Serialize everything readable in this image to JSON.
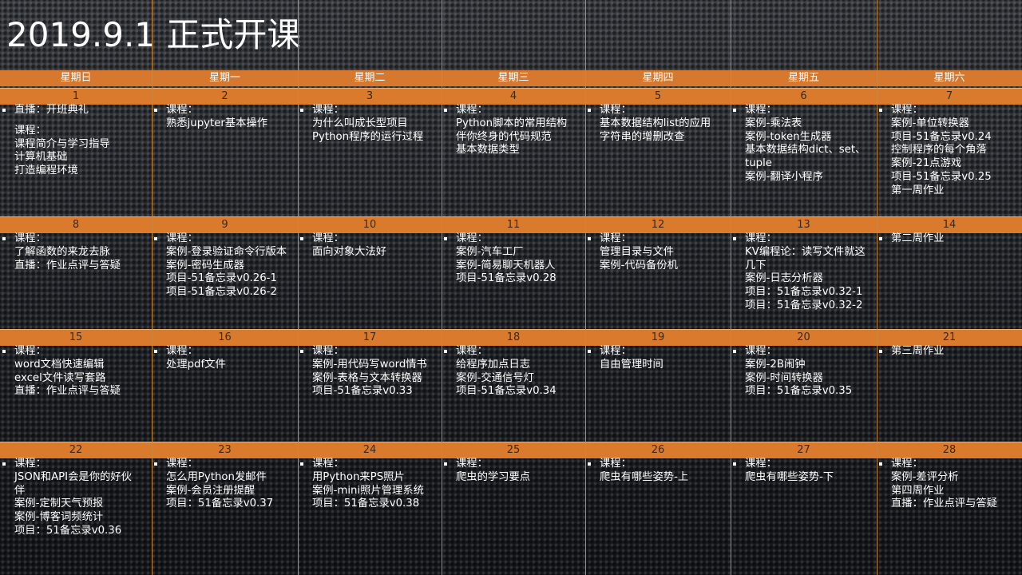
{
  "title": "2019.9.1 正式开课",
  "colors": {
    "header_bar": "#d6782e",
    "number_bar": "#d97a2d",
    "grid_line": "#c8873c",
    "text": "#ffffff"
  },
  "weekdays": [
    "星期日",
    "星期一",
    "星期二",
    "星期三",
    "星期四",
    "星期五",
    "星期六"
  ],
  "weeks": [
    {
      "days": [
        {
          "num": "1",
          "lines": [
            {
              "t": "直播：开班典礼",
              "b": true
            },
            {
              "gap": true
            },
            {
              "t": "课程：",
              "b": false
            },
            {
              "t": "课程简介与学习指导"
            },
            {
              "t": "计算机基础"
            },
            {
              "t": "打造编程环境"
            }
          ]
        },
        {
          "num": "2",
          "lines": [
            {
              "t": "课程：",
              "b": true
            },
            {
              "t": "熟悉jupyter基本操作"
            }
          ]
        },
        {
          "num": "3",
          "lines": [
            {
              "t": "课程：",
              "b": true
            },
            {
              "t": "为什么叫成长型项目"
            },
            {
              "t": "Python程序的运行过程"
            }
          ]
        },
        {
          "num": "4",
          "lines": [
            {
              "t": "课程：",
              "b": true
            },
            {
              "t": "Python脚本的常用结构"
            },
            {
              "t": "伴你终身的代码规范"
            },
            {
              "t": "基本数据类型"
            }
          ]
        },
        {
          "num": "5",
          "lines": [
            {
              "t": "课程：",
              "b": true
            },
            {
              "t": "基本数据结构list的应用"
            },
            {
              "t": "字符串的增删改查"
            }
          ]
        },
        {
          "num": "6",
          "lines": [
            {
              "t": "课程：",
              "b": true
            },
            {
              "t": "案例-乘法表"
            },
            {
              "t": "案例-token生成器"
            },
            {
              "t": "基本数据结构dict、set、"
            },
            {
              "t": "tuple"
            },
            {
              "t": "案例-翻译小程序"
            }
          ]
        },
        {
          "num": "7",
          "lines": [
            {
              "t": "课程：",
              "b": true
            },
            {
              "t": "案例-单位转换器"
            },
            {
              "t": "项目-51备忘录v0.24"
            },
            {
              "t": "控制程序的每个角落"
            },
            {
              "t": "案例-21点游戏"
            },
            {
              "t": "项目-51备忘录v0.25"
            },
            {
              "t": "第一周作业"
            }
          ]
        }
      ]
    },
    {
      "days": [
        {
          "num": "8",
          "lines": [
            {
              "t": "课程：",
              "b": true
            },
            {
              "t": "了解函数的来龙去脉"
            },
            {
              "t": "直播：作业点评与答疑"
            }
          ]
        },
        {
          "num": "9",
          "lines": [
            {
              "t": "课程：",
              "b": true
            },
            {
              "t": "案例-登录验证命令行版本"
            },
            {
              "t": "案例-密码生成器"
            },
            {
              "t": "项目-51备忘录v0.26-1"
            },
            {
              "t": "项目-51备忘录v0.26-2"
            }
          ]
        },
        {
          "num": "10",
          "lines": [
            {
              "t": "课程：",
              "b": true
            },
            {
              "t": "面向对象大法好"
            }
          ]
        },
        {
          "num": "11",
          "lines": [
            {
              "t": "课程：",
              "b": true
            },
            {
              "t": "案例-汽车工厂"
            },
            {
              "t": "案例-简易聊天机器人"
            },
            {
              "t": "项目-51备忘录v0.28"
            }
          ]
        },
        {
          "num": "12",
          "lines": [
            {
              "t": "课程：",
              "b": true
            },
            {
              "t": "管理目录与文件"
            },
            {
              "t": "案例-代码备份机"
            }
          ]
        },
        {
          "num": "13",
          "lines": [
            {
              "t": "课程：",
              "b": true
            },
            {
              "t": "KV编程论：读写文件就这"
            },
            {
              "t": "几下"
            },
            {
              "t": "案例-日志分析器"
            },
            {
              "t": "项目：51备忘录v0.32-1"
            },
            {
              "t": "项目：51备忘录v0.32-2"
            }
          ]
        },
        {
          "num": "14",
          "lines": [
            {
              "t": "第二周作业",
              "b": true
            }
          ]
        }
      ]
    },
    {
      "days": [
        {
          "num": "15",
          "lines": [
            {
              "t": "课程：",
              "b": true
            },
            {
              "t": "word文档快速编辑"
            },
            {
              "t": "excel文件读写套路"
            },
            {
              "t": "直播：作业点评与答疑"
            }
          ]
        },
        {
          "num": "16",
          "lines": [
            {
              "t": "课程：",
              "b": true
            },
            {
              "t": "处理pdf文件"
            }
          ]
        },
        {
          "num": "17",
          "lines": [
            {
              "t": "课程：",
              "b": true
            },
            {
              "t": "案例-用代码写word情书"
            },
            {
              "t": "案例-表格与文本转换器"
            },
            {
              "t": "项目-51备忘录v0.33"
            }
          ]
        },
        {
          "num": "18",
          "lines": [
            {
              "t": "课程：",
              "b": true
            },
            {
              "t": "给程序加点日志"
            },
            {
              "t": "案例-交通信号灯"
            },
            {
              "t": "项目-51备忘录v0.34"
            }
          ]
        },
        {
          "num": "19",
          "lines": [
            {
              "t": "课程：",
              "b": true
            },
            {
              "t": "自由管理时间"
            }
          ]
        },
        {
          "num": "20",
          "lines": [
            {
              "t": "课程：",
              "b": true
            },
            {
              "t": "案例-2B闹钟"
            },
            {
              "t": "案例-时间转换器"
            },
            {
              "t": "项目：51备忘录v0.35"
            }
          ]
        },
        {
          "num": "21",
          "lines": [
            {
              "t": "第三周作业",
              "b": true
            }
          ]
        }
      ]
    },
    {
      "days": [
        {
          "num": "22",
          "lines": [
            {
              "t": "课程：",
              "b": true
            },
            {
              "t": "JSON和API会是你的好伙"
            },
            {
              "t": "伴"
            },
            {
              "t": "案例-定制天气预报"
            },
            {
              "t": "案例-博客词频统计"
            },
            {
              "t": "项目：51备忘录v0.36"
            }
          ]
        },
        {
          "num": "23",
          "lines": [
            {
              "t": "课程：",
              "b": true
            },
            {
              "t": "怎么用Python发邮件"
            },
            {
              "t": "案例-会员注册提醒"
            },
            {
              "t": "项目：51备忘录v0.37"
            }
          ]
        },
        {
          "num": "24",
          "lines": [
            {
              "t": "课程：",
              "b": true
            },
            {
              "t": "用Python来PS照片"
            },
            {
              "t": "案例-mini照片管理系统"
            },
            {
              "t": "项目：51备忘录v0.38"
            }
          ]
        },
        {
          "num": "25",
          "lines": [
            {
              "t": "课程：",
              "b": true
            },
            {
              "t": "爬虫的学习要点"
            }
          ]
        },
        {
          "num": "26",
          "lines": [
            {
              "t": "课程：",
              "b": true
            },
            {
              "t": "爬虫有哪些姿势-上"
            }
          ]
        },
        {
          "num": "27",
          "lines": [
            {
              "t": "课程：",
              "b": true
            },
            {
              "t": "爬虫有哪些姿势-下"
            }
          ]
        },
        {
          "num": "28",
          "lines": [
            {
              "t": "课程：",
              "b": true
            },
            {
              "t": "案例-差评分析"
            },
            {
              "t": "第四周作业"
            },
            {
              "t": "直播：作业点评与答疑"
            }
          ]
        }
      ]
    }
  ]
}
